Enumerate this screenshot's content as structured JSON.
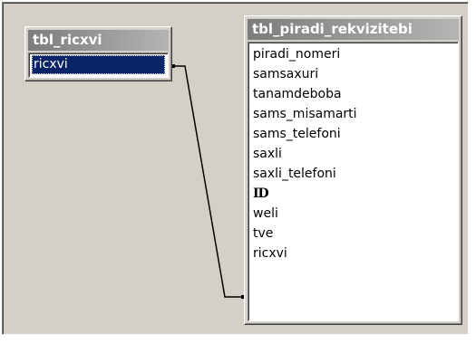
{
  "tables": {
    "left": {
      "title": "tbl_ricxvi",
      "fields": [
        "ricxvi"
      ],
      "selected_field": "ricxvi"
    },
    "right": {
      "title": "tbl_piradi_rekvizitebi",
      "fields": [
        "piradi_nomeri",
        "samsaxuri",
        "tanamdeboba",
        "sams_misamarti",
        "sams_telefoni",
        "saxli",
        "saxli_telefoni",
        "ID",
        "weli",
        "tve",
        "ricxvi"
      ],
      "key_field": "ID"
    }
  },
  "relationship": {
    "from": "tbl_ricxvi.ricxvi",
    "to": "tbl_piradi_rekvizitebi.ricxvi"
  },
  "colors": {
    "workspace": "#d4d0c8",
    "selection": "#0a246a",
    "title_gradient_start": "#7c7c7c",
    "title_gradient_end": "#b4b4b4"
  }
}
